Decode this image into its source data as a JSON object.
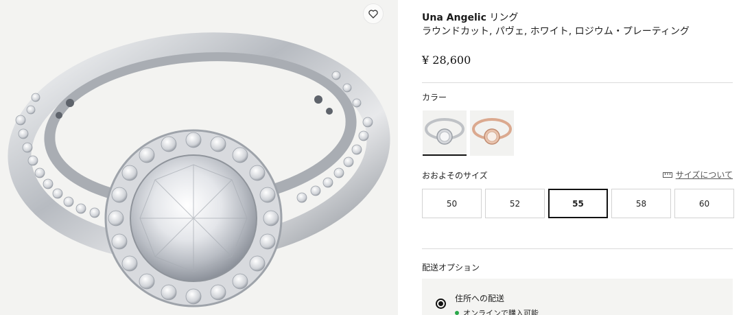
{
  "product": {
    "brand_name": "Una Angelic",
    "name_suffix": " リング",
    "subtitle": "ラウンドカット, パヴェ, ホワイト, ロジウム・プレーティング",
    "price": "¥ 28,600"
  },
  "color": {
    "label": "カラー",
    "options": [
      {
        "name": "ホワイト, ロジウム",
        "selected": true,
        "metal": "#c9ccd0"
      },
      {
        "name": "ローズゴールド",
        "selected": false,
        "metal": "#d9a88e"
      }
    ]
  },
  "size": {
    "label": "おおよそのサイズ",
    "guide_link": "サイズについて",
    "options": [
      "50",
      "52",
      "55",
      "58",
      "60"
    ],
    "selected": "55"
  },
  "shipping": {
    "label": "配送オプション",
    "option_title": "住所への配送",
    "status": "オンラインで購入可能",
    "status_color": "#2aa84a"
  },
  "gallery": {
    "wishlist_icon": "heart-icon"
  }
}
